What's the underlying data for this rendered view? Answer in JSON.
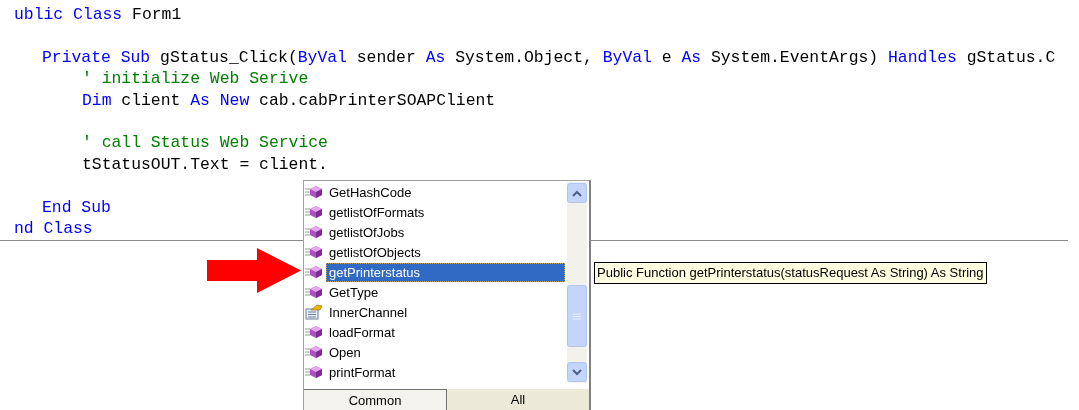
{
  "code_lines": [
    {
      "kind": "code",
      "tokens": [
        {
          "kind": "keyword",
          "text": "ublic Class"
        },
        {
          "kind": "plain",
          "text": " Form1"
        }
      ],
      "children": [
        {
          "kind": "blank"
        },
        {
          "kind": "code",
          "tokens": [
            {
              "kind": "keyword",
              "text": "Private Sub"
            },
            {
              "kind": "plain",
              "text": " gStatus_Click("
            },
            {
              "kind": "keyword",
              "text": "ByVal"
            },
            {
              "kind": "plain",
              "text": " sender "
            },
            {
              "kind": "keyword",
              "text": "As"
            },
            {
              "kind": "plain",
              "text": " System.Object, "
            },
            {
              "kind": "keyword",
              "text": "ByVal"
            },
            {
              "kind": "plain",
              "text": " e "
            },
            {
              "kind": "keyword",
              "text": "As"
            },
            {
              "kind": "plain",
              "text": " System.EventArgs) "
            },
            {
              "kind": "keyword",
              "text": "Handles"
            },
            {
              "kind": "plain",
              "text": " gStatus.C"
            }
          ],
          "children": [
            {
              "kind": "code",
              "tokens": [
                {
                  "kind": "comment",
                  "text": "' initialize Web Serive"
                }
              ]
            },
            {
              "kind": "code",
              "tokens": [
                {
                  "kind": "keyword",
                  "text": "Dim"
                },
                {
                  "kind": "plain",
                  "text": " client "
                },
                {
                  "kind": "keyword",
                  "text": "As New"
                },
                {
                  "kind": "plain",
                  "text": " cab.cabPrinterSOAPClient"
                }
              ]
            },
            {
              "kind": "blank"
            },
            {
              "kind": "code",
              "tokens": [
                {
                  "kind": "comment",
                  "text": "' call Status Web Service"
                }
              ]
            },
            {
              "kind": "code",
              "tokens": [
                {
                  "kind": "plain",
                  "text": "tStatusOUT.Text = client."
                }
              ]
            },
            {
              "kind": "blank"
            }
          ]
        },
        {
          "kind": "code",
          "tokens": [
            {
              "kind": "keyword",
              "text": "End Sub"
            }
          ]
        }
      ]
    },
    {
      "kind": "code",
      "tokens": [
        {
          "kind": "keyword",
          "text": "nd Class"
        }
      ]
    }
  ],
  "completion_list": {
    "items": [
      {
        "label": "GetHashCode",
        "kind": "method",
        "selected": false
      },
      {
        "label": "getlistOfFormats",
        "kind": "method",
        "selected": false
      },
      {
        "label": "getlistOfJobs",
        "kind": "method",
        "selected": false
      },
      {
        "label": "getlistOfObjects",
        "kind": "method",
        "selected": false
      },
      {
        "label": "getPrinterstatus",
        "kind": "method",
        "selected": true
      },
      {
        "label": "GetType",
        "kind": "method",
        "selected": false
      },
      {
        "label": "InnerChannel",
        "kind": "property",
        "selected": false
      },
      {
        "label": "loadFormat",
        "kind": "method",
        "selected": false
      },
      {
        "label": "Open",
        "kind": "method",
        "selected": false
      },
      {
        "label": "printFormat",
        "kind": "method",
        "selected": false
      }
    ],
    "tabs": [
      {
        "label": "Common",
        "selected": true
      },
      {
        "label": "All",
        "selected": false
      }
    ]
  },
  "tooltip": "Public Function getPrinterstatus(statusRequest As String) As String"
}
